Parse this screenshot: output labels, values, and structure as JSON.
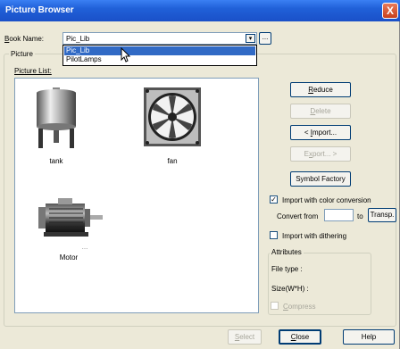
{
  "window": {
    "title": "Picture Browser",
    "close_symbol": "X"
  },
  "book": {
    "label_u": "B",
    "label_rest": "ook Name:",
    "value": "Pic_Lib",
    "dropdown_arrow": "▾",
    "browse_label": "...",
    "options": [
      "Pic_Lib",
      "PilotLamps"
    ]
  },
  "picture_group": {
    "title": "Picture",
    "list_label": "Picture List:"
  },
  "pictures": [
    {
      "caption": "tank",
      "icon": "tank-image"
    },
    {
      "caption": "fan",
      "icon": "fan-image"
    },
    {
      "caption": "Motor",
      "icon": "motor-image"
    }
  ],
  "buttons": {
    "reduce_u": "R",
    "reduce_rest": "educe",
    "delete_u": "D",
    "delete_rest": "elete",
    "import_pre": "< ",
    "import_u": "I",
    "import_rest": "mport...",
    "export_pre": "E",
    "export_u": "x",
    "export_rest": "port... >",
    "symbol_factory": "Symbol Factory",
    "transp": "Transp.",
    "select_u": "S",
    "select_rest": "elect",
    "close_u": "C",
    "close_rest": "lose",
    "help": "Help"
  },
  "import_options": {
    "color_conversion_label": "Import with color conversion",
    "color_conversion_checked": true,
    "convert_from_label": "Convert from",
    "convert_from_value": "",
    "to_label": "to",
    "dithering_label": "Import with dithering",
    "dithering_checked": false
  },
  "attributes": {
    "title": "Attributes",
    "file_type_label": "File type :",
    "size_label": "Size(W*H) :",
    "compress_u": "C",
    "compress_rest": "ompress",
    "compress_checked": false
  },
  "colors": {
    "title_bar": "#2060d8",
    "selection": "#316ac5",
    "dialog_bg": "#ece9d8"
  }
}
